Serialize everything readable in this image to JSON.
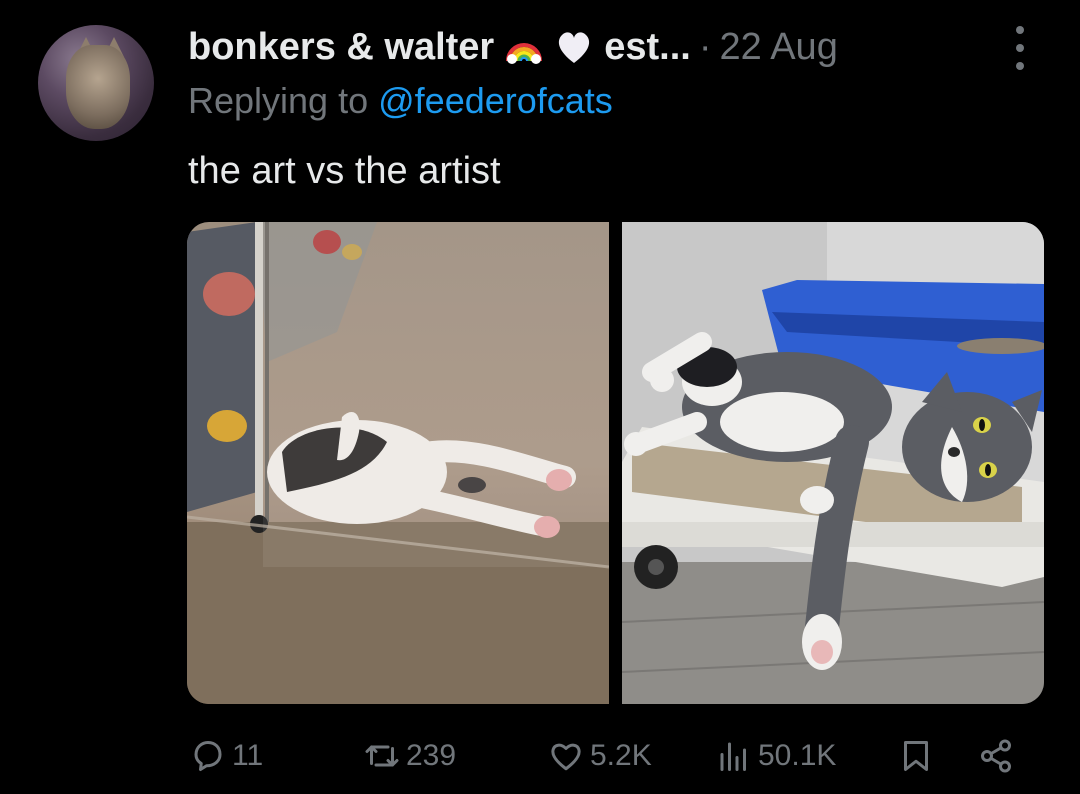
{
  "tweet": {
    "display_name": "bonkers & walter",
    "display_name_emojis": [
      "rainbow-emoji",
      "white-heart-emoji"
    ],
    "name_truncated_suffix": "est...",
    "separator": "·",
    "date": "22 Aug",
    "replying_prefix": "Replying to",
    "replying_handle": "@feederofcats",
    "text": "the art vs the artist"
  },
  "media": [
    {
      "icon": "cat-behind-glass-photo"
    },
    {
      "icon": "cat-lying-on-litter-box-photo"
    }
  ],
  "actions": {
    "replies": "11",
    "reposts": "239",
    "likes": "5.2K",
    "views": "50.1K"
  },
  "colors": {
    "background": "#000000",
    "text": "#e7e9ea",
    "muted": "#71767b",
    "link": "#1d9bf0"
  }
}
